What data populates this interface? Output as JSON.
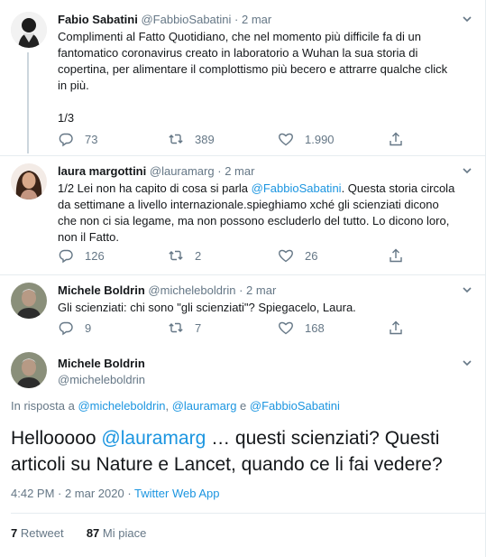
{
  "tweets": [
    {
      "name": "Fabio Sabatini",
      "handle": "@FabbioSabatini",
      "date": "2 mar",
      "text_lines": [
        "Complimenti al Fatto Quotidiano, che nel momento più difficile fa di un",
        "fantomatico coronavirus creato in laboratorio a Wuhan la sua storia di",
        "copertina, per alimentare il complottismo più becero e attrarre qualche click",
        "in più.",
        "",
        "1/3"
      ],
      "replies": "73",
      "retweets": "389",
      "likes": "1.990"
    },
    {
      "name": "laura margottini",
      "handle": "@lauramarg",
      "date": "2 mar",
      "text_prefix": "1/2 Lei non ha capito di cosa si parla ",
      "text_mention": "@FabbioSabatini",
      "text_suffix": ". Questa storia circola",
      "text_lines": [
        "da settimane a livello internazionale.spieghiamo xché gli scienziati dicono",
        "che non ci sia legame, ma non possono escluderlo del tutto. Lo dicono loro,",
        "non il Fatto."
      ],
      "replies": "126",
      "retweets": "2",
      "likes": "26"
    },
    {
      "name": "Michele Boldrin",
      "handle": "@micheleboldrin",
      "date": "2 mar",
      "text": "Gli scienziati: chi sono \"gli scienziati\"? Spiegacelo, Laura.",
      "replies": "9",
      "retweets": "7",
      "likes": "168"
    }
  ],
  "main_tweet": {
    "name": "Michele Boldrin",
    "handle": "@micheleboldrin",
    "reply_prefix": "In risposta a ",
    "reply_mention_1": "@micheleboldrin",
    "reply_sep_1": ", ",
    "reply_mention_2": "@lauramarg",
    "reply_sep_2": " e ",
    "reply_mention_3": "@FabbioSabatini",
    "text_line1_prefix": "Hellooooo ",
    "text_line1_mention": "@lauramarg",
    "text_line1_suffix": " … questi scienziati? Questi",
    "text_line2": "articoli su Nature e Lancet, quando ce li fai vedere?",
    "time": "4:42 PM · 2 mar 2020 · ",
    "source": "Twitter Web App",
    "retweets_count": "7",
    "retweets_label": "Retweet",
    "likes_count": "87",
    "likes_label": "Mi piace"
  },
  "colors": {
    "accent": "#1b95e0",
    "muted": "#657786",
    "divider": "#e6ecf0"
  },
  "icons": [
    "reply-icon",
    "retweet-icon",
    "like-icon",
    "share-icon",
    "chevron-down-icon"
  ]
}
